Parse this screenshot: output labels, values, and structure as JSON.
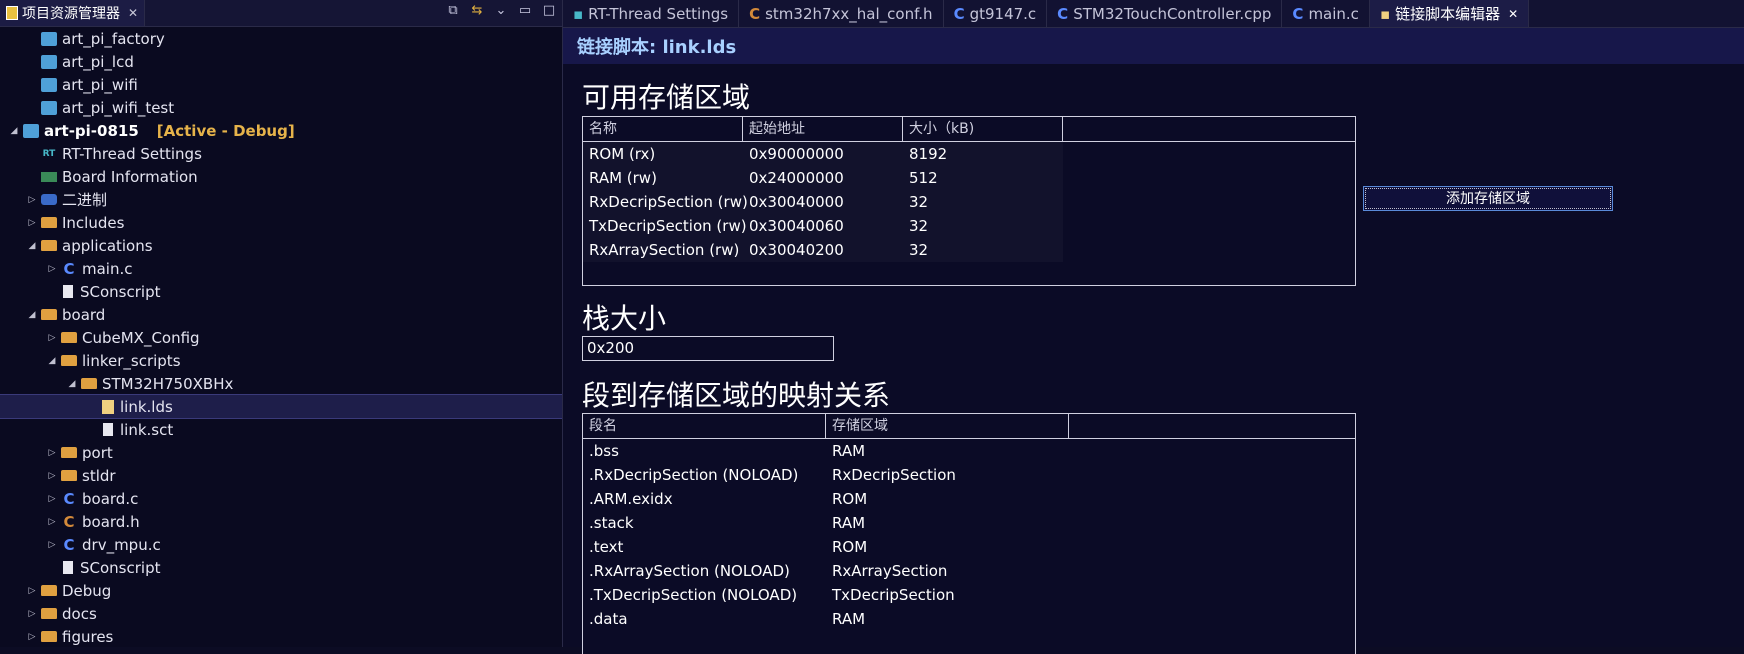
{
  "explorer": {
    "tab_title": "项目资源管理器",
    "tree": [
      {
        "label": "art_pi_factory",
        "type": "project",
        "level": 1,
        "twisty": ""
      },
      {
        "label": "art_pi_lcd",
        "type": "project",
        "level": 1,
        "twisty": ""
      },
      {
        "label": "art_pi_wifi",
        "type": "project",
        "level": 1,
        "twisty": ""
      },
      {
        "label": "art_pi_wifi_test",
        "type": "project",
        "level": 1,
        "twisty": ""
      },
      {
        "label": "art-pi-0815",
        "type": "project-active",
        "level": 0,
        "twisty": "open",
        "tag": "[Active - Debug]"
      },
      {
        "label": "RT-Thread Settings",
        "type": "rt",
        "level": 1,
        "twisty": ""
      },
      {
        "label": "Board Information",
        "type": "board",
        "level": 1,
        "twisty": ""
      },
      {
        "label": "二进制",
        "type": "bin",
        "level": 1,
        "twisty": "closed"
      },
      {
        "label": "Includes",
        "type": "folder",
        "level": 1,
        "twisty": "closed"
      },
      {
        "label": "applications",
        "type": "folder",
        "level": 1,
        "twisty": "open"
      },
      {
        "label": "main.c",
        "type": "c",
        "level": 2,
        "twisty": "closed"
      },
      {
        "label": "SConscript",
        "type": "file",
        "level": 2,
        "twisty": ""
      },
      {
        "label": "board",
        "type": "folder",
        "level": 1,
        "twisty": "open"
      },
      {
        "label": "CubeMX_Config",
        "type": "folder",
        "level": 2,
        "twisty": "closed"
      },
      {
        "label": "linker_scripts",
        "type": "folder",
        "level": 2,
        "twisty": "open"
      },
      {
        "label": "STM32H750XBHx",
        "type": "folder",
        "level": 3,
        "twisty": "open"
      },
      {
        "label": "link.lds",
        "type": "lds",
        "level": 4,
        "twisty": "",
        "selected": true
      },
      {
        "label": "link.sct",
        "type": "file",
        "level": 4,
        "twisty": ""
      },
      {
        "label": "port",
        "type": "folder",
        "level": 2,
        "twisty": "closed"
      },
      {
        "label": "stldr",
        "type": "folder",
        "level": 2,
        "twisty": "closed"
      },
      {
        "label": "board.c",
        "type": "c",
        "level": 2,
        "twisty": "closed"
      },
      {
        "label": "board.h",
        "type": "h",
        "level": 2,
        "twisty": "closed"
      },
      {
        "label": "drv_mpu.c",
        "type": "c",
        "level": 2,
        "twisty": "closed"
      },
      {
        "label": "SConscript",
        "type": "file",
        "level": 2,
        "twisty": ""
      },
      {
        "label": "Debug",
        "type": "folder",
        "level": 1,
        "twisty": "closed"
      },
      {
        "label": "docs",
        "type": "folder",
        "level": 1,
        "twisty": "closed"
      },
      {
        "label": "figures",
        "type": "folder",
        "level": 1,
        "twisty": "closed"
      }
    ]
  },
  "tabs": [
    {
      "label": "RT-Thread Settings",
      "icon": "rt"
    },
    {
      "label": "stm32h7xx_hal_conf.h",
      "icon": "h"
    },
    {
      "label": "gt9147.c",
      "icon": "c"
    },
    {
      "label": "STM32TouchController.cpp",
      "icon": "c"
    },
    {
      "label": "main.c",
      "icon": "c"
    },
    {
      "label": "链接脚本编辑器",
      "icon": "lds",
      "active": true
    }
  ],
  "editor": {
    "title": "链接脚本: link.lds",
    "memory_section_title": "可用存储区域",
    "memory_columns": [
      "名称",
      "起始地址",
      "大小（kB)"
    ],
    "memory_rows": [
      [
        "ROM (rx)",
        "0x90000000",
        "8192"
      ],
      [
        "RAM (rw)",
        "0x24000000",
        "512"
      ],
      [
        "RxDecripSection (rw)",
        "0x30040000",
        "32"
      ],
      [
        "TxDecripSection (rw)",
        "0x30040060",
        "32"
      ],
      [
        "RxArraySection (rw)",
        "0x30040200",
        "32"
      ]
    ],
    "add_region_button": "添加存储区域",
    "stack_section_title": "栈大小",
    "stack_value": "0x200",
    "mapping_section_title": "段到存储区域的映射关系",
    "mapping_columns": [
      "段名",
      "存储区域"
    ],
    "mapping_rows": [
      [
        ".bss",
        "RAM"
      ],
      [
        ".RxDecripSection (NOLOAD)",
        "RxDecripSection"
      ],
      [
        ".ARM.exidx",
        "ROM"
      ],
      [
        ".stack",
        "RAM"
      ],
      [
        ".text",
        "ROM"
      ],
      [
        ".RxArraySection (NOLOAD)",
        "RxArraySection"
      ],
      [
        ".TxDecripSection (NOLOAD)",
        "TxDecripSection"
      ],
      [
        ".data",
        "RAM"
      ]
    ]
  }
}
